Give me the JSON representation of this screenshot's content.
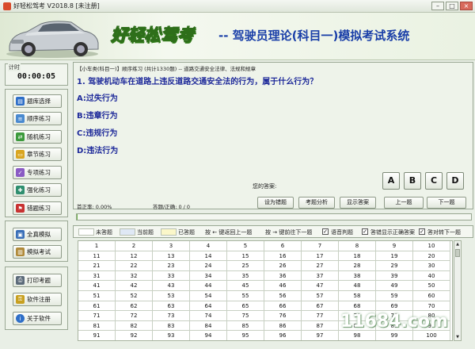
{
  "window": {
    "title": "好轻松驾考 V2018.8 [未注册]"
  },
  "header": {
    "brand": "好轻松驾考",
    "subtitle": "-- 驾驶员理论(科目一)模拟考试系统"
  },
  "sidebar": {
    "timer_label": "计时",
    "timer_value": "00:00:05",
    "items": [
      {
        "label": "题库选择",
        "icon": "database-icon"
      },
      {
        "label": "顺序练习",
        "icon": "list-icon"
      },
      {
        "label": "随机练习",
        "icon": "shuffle-icon"
      },
      {
        "label": "章节练习",
        "icon": "folder-icon"
      },
      {
        "label": "专项练习",
        "icon": "check-icon"
      },
      {
        "label": "强化练习",
        "icon": "strength-icon"
      },
      {
        "label": "错题练习",
        "icon": "flag-icon"
      },
      {
        "label": "全真模拟",
        "icon": "screen-icon"
      },
      {
        "label": "模拟考试",
        "icon": "document-icon"
      },
      {
        "label": "打印考题",
        "icon": "printer-icon"
      },
      {
        "label": "软件注册",
        "icon": "key-icon"
      },
      {
        "label": "关于软件",
        "icon": "info-icon"
      }
    ]
  },
  "question": {
    "header": "【小车类(科目一)】顺序练习 (共计1330题) -- 道路交通安全法律、法规和规章",
    "text": "1. 驾驶机动车在道路上违反道路交通安全法的行为，属于什么行为？",
    "options": [
      "A:过失行为",
      "B:违章行为",
      "C:违规行为",
      "D:违法行为"
    ]
  },
  "answer": {
    "label": "您的答案:",
    "buttons": [
      "A",
      "B",
      "C",
      "D"
    ]
  },
  "stats": {
    "accuracy": "首正率: 0.00%",
    "answered": "答题/正确: 0 / 0"
  },
  "actions": [
    "设为错题",
    "考题分析",
    "显示答案",
    "上一题",
    "下一题"
  ],
  "progress": {
    "value": 0.001
  },
  "legend": {
    "unanswered": "未答题",
    "current": "当前题",
    "answered": "已答题",
    "prev_hint": "按 ← 键返回上一题",
    "next_hint": "按 → 键前往下一题",
    "opt_voice": "语音判题",
    "opt_show_correct": "答错显示正确答案",
    "opt_auto_next": "答对转下一题"
  },
  "grid": {
    "rows": [
      [
        "1",
        "2",
        "3",
        "4",
        "5",
        "6",
        "7",
        "8",
        "9",
        "10"
      ],
      [
        "11",
        "12",
        "13",
        "14",
        "15",
        "16",
        "17",
        "18",
        "19",
        "20"
      ],
      [
        "21",
        "22",
        "23",
        "24",
        "25",
        "26",
        "27",
        "28",
        "29",
        "30"
      ],
      [
        "31",
        "32",
        "33",
        "34",
        "35",
        "36",
        "37",
        "38",
        "39",
        "40"
      ],
      [
        "41",
        "42",
        "43",
        "44",
        "45",
        "46",
        "47",
        "48",
        "49",
        "50"
      ],
      [
        "51",
        "52",
        "53",
        "54",
        "55",
        "56",
        "57",
        "58",
        "59",
        "60"
      ],
      [
        "61",
        "62",
        "63",
        "64",
        "65",
        "66",
        "67",
        "68",
        "69",
        "70"
      ],
      [
        "71",
        "72",
        "73",
        "74",
        "75",
        "76",
        "77",
        "78",
        "79",
        "80"
      ],
      [
        "81",
        "82",
        "83",
        "84",
        "85",
        "86",
        "87",
        "88",
        "89",
        "90"
      ],
      [
        "91",
        "92",
        "93",
        "94",
        "95",
        "96",
        "97",
        "98",
        "99",
        "100"
      ]
    ]
  },
  "watermark": "11684.com",
  "colors": {
    "accent": "#1e2a9a",
    "brand_green": "#2f7a17",
    "current_cell": "#dfe8f5",
    "answered_cell": "#fbf7c9"
  }
}
